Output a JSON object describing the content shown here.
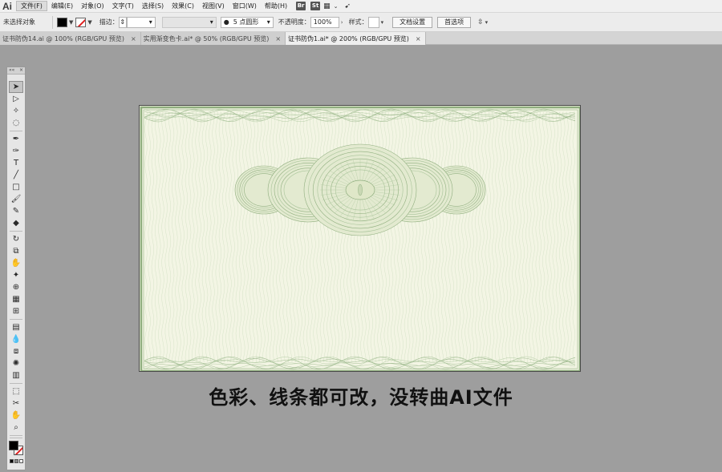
{
  "app": {
    "logo": "Ai"
  },
  "menu": [
    "文件(F)",
    "编辑(E)",
    "对象(O)",
    "文字(T)",
    "选择(S)",
    "效果(C)",
    "视图(V)",
    "窗口(W)",
    "帮助(H)"
  ],
  "menu_badges": [
    "Br",
    "St"
  ],
  "control": {
    "selection_status": "未选择对象",
    "stroke_label": "描边：",
    "brush_label": "5 点圆形",
    "opacity_label": "不透明度：",
    "opacity_value": "100%",
    "style_label": "样式：",
    "doc_setup_button": "文档设置",
    "preferences_button": "首选项"
  },
  "tabs": [
    {
      "label": "证书防伪14.ai @ 100% (RGB/GPU 预览)",
      "active": false
    },
    {
      "label": "实用渐变色卡.ai* @ 50% (RGB/GPU 预览)",
      "active": false
    },
    {
      "label": "证书防伪1.ai* @ 200% (RGB/GPU 预览)",
      "active": true
    }
  ],
  "tab_close_glyph": "×",
  "tools_panel": {
    "collapse_glyph": "««",
    "close_glyph": "×"
  },
  "tools": [
    {
      "name": "selection-tool-icon",
      "glyph": "➤",
      "active": true
    },
    {
      "name": "direct-selection-tool-icon",
      "glyph": "▷"
    },
    {
      "name": "magic-wand-tool-icon",
      "glyph": "✧"
    },
    {
      "name": "lasso-tool-icon",
      "glyph": "◌"
    },
    {
      "name": "pen-tool-icon",
      "glyph": "✒"
    },
    {
      "name": "curvature-tool-icon",
      "glyph": "✑"
    },
    {
      "name": "type-tool-icon",
      "glyph": "T"
    },
    {
      "name": "line-tool-icon",
      "glyph": "╱"
    },
    {
      "name": "rectangle-tool-icon",
      "glyph": "□"
    },
    {
      "name": "paintbrush-tool-icon",
      "glyph": "🖌"
    },
    {
      "name": "shaper-tool-icon",
      "glyph": "✎"
    },
    {
      "name": "eraser-tool-icon",
      "glyph": "◆"
    },
    {
      "name": "rotate-tool-icon",
      "glyph": "↻"
    },
    {
      "name": "scale-tool-icon",
      "glyph": "⧉"
    },
    {
      "name": "warp-tool-icon",
      "glyph": "✋"
    },
    {
      "name": "puppet-warp-tool-icon",
      "glyph": "✦"
    },
    {
      "name": "shape-builder-tool-icon",
      "glyph": "⊕"
    },
    {
      "name": "perspective-grid-tool-icon",
      "glyph": "▦"
    },
    {
      "name": "mesh-tool-icon",
      "glyph": "⊞"
    },
    {
      "name": "gradient-tool-icon",
      "glyph": "▤"
    },
    {
      "name": "eyedropper-tool-icon",
      "glyph": "💧"
    },
    {
      "name": "blend-tool-icon",
      "glyph": "⧈"
    },
    {
      "name": "symbol-sprayer-tool-icon",
      "glyph": "✺"
    },
    {
      "name": "column-graph-tool-icon",
      "glyph": "▥"
    },
    {
      "name": "artboard-tool-icon",
      "glyph": "⬚"
    },
    {
      "name": "slice-tool-icon",
      "glyph": "✂"
    },
    {
      "name": "hand-tool-icon",
      "glyph": "✋"
    },
    {
      "name": "zoom-tool-icon",
      "glyph": "⌕"
    }
  ],
  "artboard": {
    "background": "#f3f5e4",
    "pattern_color": "#a9c49a",
    "pattern_dark": "#8fae7e"
  },
  "caption": "色彩、线条都可改，没转曲AI文件"
}
